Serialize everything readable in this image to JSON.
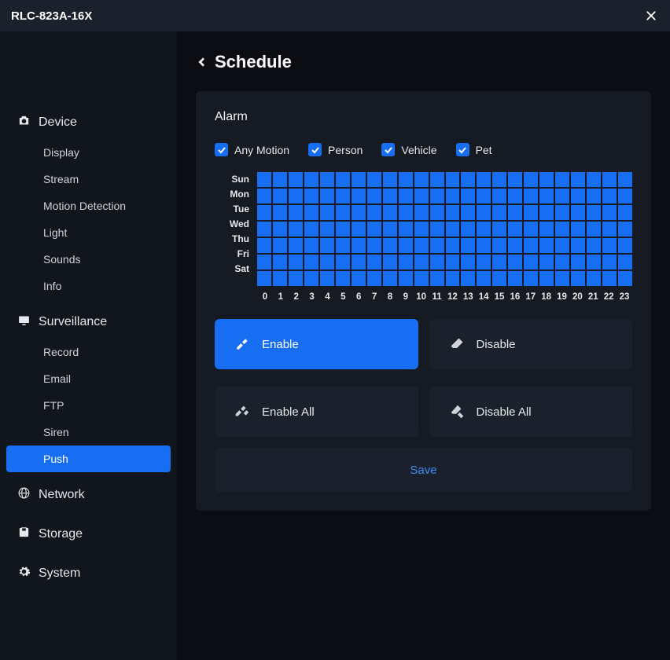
{
  "window": {
    "title": "RLC-823A-16X"
  },
  "sidebar": {
    "sections": [
      {
        "label": "Device",
        "icon": "camera-icon",
        "items": [
          "Display",
          "Stream",
          "Motion Detection",
          "Light",
          "Sounds",
          "Info"
        ]
      },
      {
        "label": "Surveillance",
        "icon": "monitor-icon",
        "items": [
          "Record",
          "Email",
          "FTP",
          "Siren",
          "Push"
        ],
        "active_index": 4
      },
      {
        "label": "Network",
        "icon": "globe-icon",
        "items": []
      },
      {
        "label": "Storage",
        "icon": "disk-icon",
        "items": []
      },
      {
        "label": "System",
        "icon": "gear-icon",
        "items": []
      }
    ]
  },
  "page": {
    "title": "Schedule"
  },
  "panel": {
    "title": "Alarm",
    "filters": [
      {
        "label": "Any Motion",
        "checked": true
      },
      {
        "label": "Person",
        "checked": true
      },
      {
        "label": "Vehicle",
        "checked": true
      },
      {
        "label": "Pet",
        "checked": true
      }
    ],
    "days": [
      "Sun",
      "Mon",
      "Tue",
      "Wed",
      "Thu",
      "Fri",
      "Sat"
    ],
    "hours": [
      "0",
      "1",
      "2",
      "3",
      "4",
      "5",
      "6",
      "7",
      "8",
      "9",
      "10",
      "11",
      "12",
      "13",
      "14",
      "15",
      "16",
      "17",
      "18",
      "19",
      "20",
      "21",
      "22",
      "23"
    ],
    "schedule": [
      [
        1,
        1,
        1,
        1,
        1,
        1,
        1,
        1,
        1,
        1,
        1,
        1,
        1,
        1,
        1,
        1,
        1,
        1,
        1,
        1,
        1,
        1,
        1,
        1
      ],
      [
        1,
        1,
        1,
        1,
        1,
        1,
        1,
        1,
        1,
        1,
        1,
        1,
        1,
        1,
        1,
        1,
        1,
        1,
        1,
        1,
        1,
        1,
        1,
        1
      ],
      [
        1,
        1,
        1,
        1,
        1,
        1,
        1,
        1,
        1,
        1,
        1,
        1,
        1,
        1,
        1,
        1,
        1,
        1,
        1,
        1,
        1,
        1,
        1,
        1
      ],
      [
        1,
        1,
        1,
        1,
        1,
        1,
        1,
        1,
        1,
        1,
        1,
        1,
        1,
        1,
        1,
        1,
        1,
        1,
        1,
        1,
        1,
        1,
        1,
        1
      ],
      [
        1,
        1,
        1,
        1,
        1,
        1,
        1,
        1,
        1,
        1,
        1,
        1,
        1,
        1,
        1,
        1,
        1,
        1,
        1,
        1,
        1,
        1,
        1,
        1
      ],
      [
        1,
        1,
        1,
        1,
        1,
        1,
        1,
        1,
        1,
        1,
        1,
        1,
        1,
        1,
        1,
        1,
        1,
        1,
        1,
        1,
        1,
        1,
        1,
        1
      ],
      [
        1,
        1,
        1,
        1,
        1,
        1,
        1,
        1,
        1,
        1,
        1,
        1,
        1,
        1,
        1,
        1,
        1,
        1,
        1,
        1,
        1,
        1,
        1,
        1
      ]
    ],
    "buttons": {
      "enable": "Enable",
      "disable": "Disable",
      "enable_all": "Enable All",
      "disable_all": "Disable All",
      "save": "Save"
    }
  },
  "colors": {
    "accent": "#176ef2"
  }
}
